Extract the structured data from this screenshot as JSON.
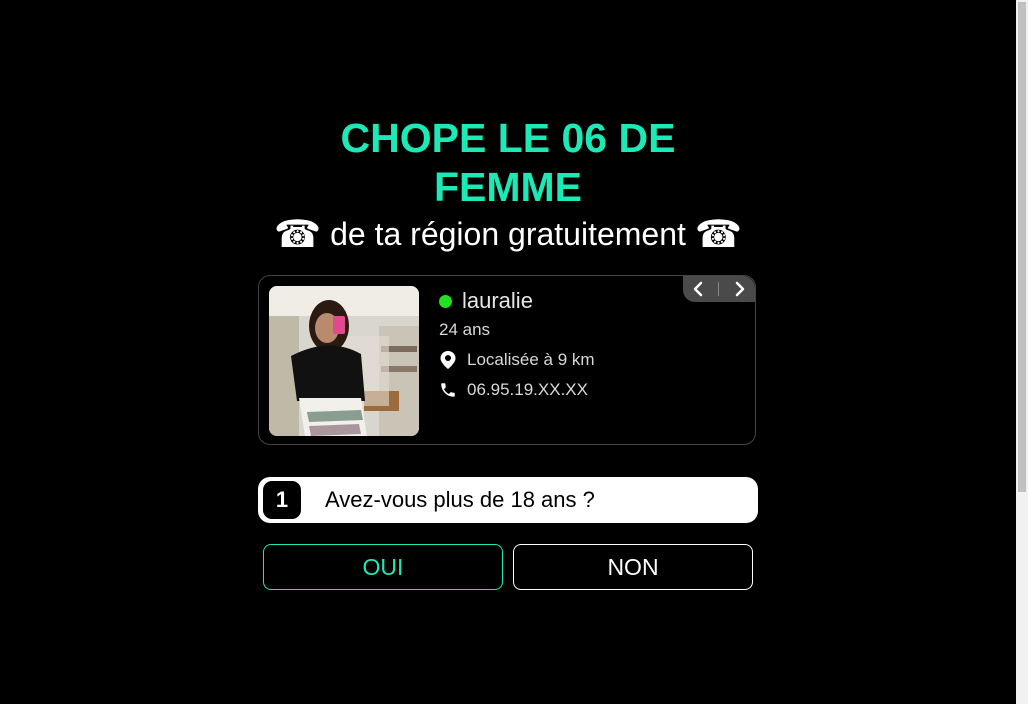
{
  "headline": {
    "line1": "CHOPE LE 06 DE",
    "line2": "FEMME"
  },
  "subline": {
    "text": "de ta région gratuitement",
    "icon_left": "☎",
    "icon_right": "☎"
  },
  "profile": {
    "name": "lauralie",
    "age": "24 ans",
    "location": "Localisée à 9 km",
    "phone": "06.95.19.XX.XX",
    "status_color": "#22e022"
  },
  "question": {
    "number": "1",
    "text": "Avez-vous plus de 18 ans ?"
  },
  "buttons": {
    "yes": "OUI",
    "no": "NON"
  },
  "colors": {
    "accent": "#1de9b6",
    "background": "#000000"
  }
}
